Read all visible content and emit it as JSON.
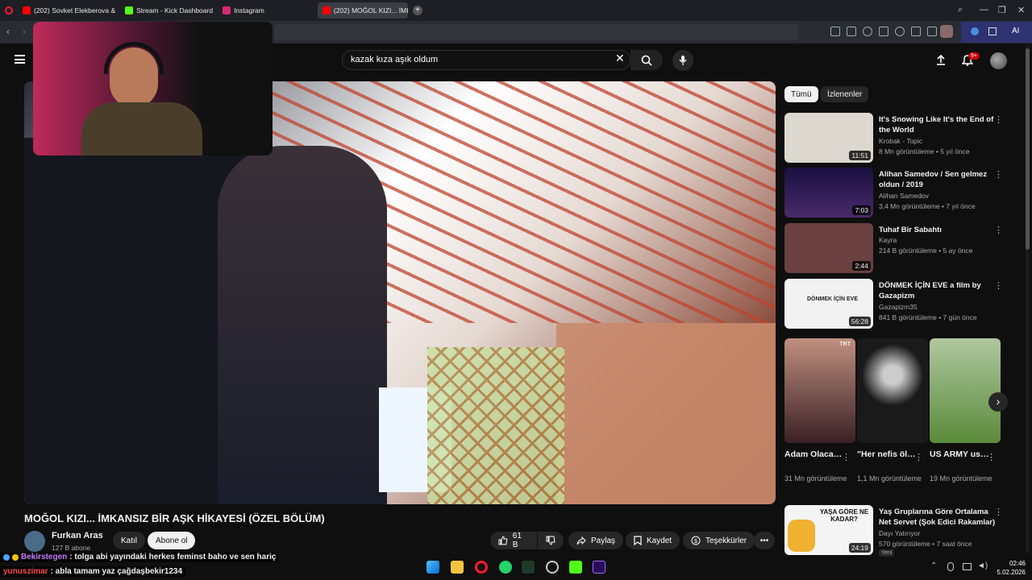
{
  "browser": {
    "tabs": [
      {
        "label": "(202) Sovket Elekberova &",
        "color": "#ff0000"
      },
      {
        "label": "Stream - Kick Dashboard",
        "color": "#53fc18"
      },
      {
        "label": "Instagram",
        "color": "#d62976"
      },
      {
        "label": "(202) MOĞOL KIZI... İMKA",
        "color": "#ff0000",
        "active": true
      }
    ],
    "new_tab": "+",
    "ai_label": "AI"
  },
  "youtube": {
    "search_value": "kazak kıza aşık oldum",
    "notification_badge": "9+",
    "video": {
      "title": "MOĞOL KIZI... İMKANSIZ BİR AŞK HİKAYESİ (ÖZEL BÖLÜM)",
      "channel": "Furkan Aras",
      "subscribers": "127 B abone",
      "join_label": "Katıl",
      "subscribe_label": "Abone ol",
      "likes": "61 B",
      "share_label": "Paylaş",
      "save_label": "Kaydet",
      "thanks_label": "Teşekkürler"
    },
    "chips": [
      "Tümü",
      "İzlenenler"
    ],
    "recommendations": [
      {
        "title": "It's Snowing Like It's the End of the World",
        "channel": "Krobak - Topic",
        "meta": "8 Mn görüntüleme • 5 yıl önce",
        "duration": "11:51",
        "thumb": "#dcd8cf"
      },
      {
        "title": "Alihan Samedov / Sen gelmez oldun / 2019",
        "channel": "Alihan Samedov",
        "meta": "3,4 Mn görüntüleme • 7 yıl önce",
        "duration": "7:03",
        "thumb": "#3a2a5a"
      },
      {
        "title": "Tuhaf Bir Sabahtı",
        "channel": "Kayra",
        "meta": "214 B görüntüleme • 5 ay önce",
        "duration": "2:44",
        "thumb": "#6a4040"
      },
      {
        "title": "DÖNMEK İÇİN EVE a film by Gazapizm",
        "channel": "Gazapizm35",
        "meta": "841 B görüntüleme • 7 gün önce",
        "duration": "56:28",
        "thumb": "#f2f2f2"
      },
      {
        "title": "Yaş Gruplarına Göre Ortalama Net Servet (Şok Edici Rakamlar)",
        "channel": "Dayı Yatırıyor",
        "meta": "570 görüntüleme • 7 saat önce",
        "duration": "24:19",
        "thumb": "#f4f4f4"
      }
    ],
    "shorts": [
      {
        "title": "Adam Olacak Çocuk Uğur...",
        "views": "31 Mn görüntüleme",
        "tag": "TRT",
        "thumb": "#3a2025"
      },
      {
        "title": "\"Her nefis ölümü ...",
        "views": "1,1 Mn görüntüleme",
        "tag": "",
        "thumb": "#1a1a1a"
      },
      {
        "title": "US ARMY us XM7 Rifle / ...",
        "views": "19 Mn görüntüleme",
        "tag": "",
        "thumb": "#5a8a3a"
      }
    ],
    "thumb_text_1": "DÖNMEK İÇİN EVE",
    "thumb_text_2": "YAŞA GÖRE NE KADAR?",
    "new_badge": "Yeni"
  },
  "chat": [
    {
      "user": "Bekirstegen",
      "user_color": "#c27bff",
      "message": ": tolga abi yayındaki herkes feminst baho ve sen hariç"
    },
    {
      "user": "yunuszimar",
      "user_color": "#ff4a4a",
      "message": ": abla tamam yaz çağdaşbekir1234"
    }
  ],
  "taskbar": {
    "time": "02:46",
    "date": "5.02.2026"
  }
}
